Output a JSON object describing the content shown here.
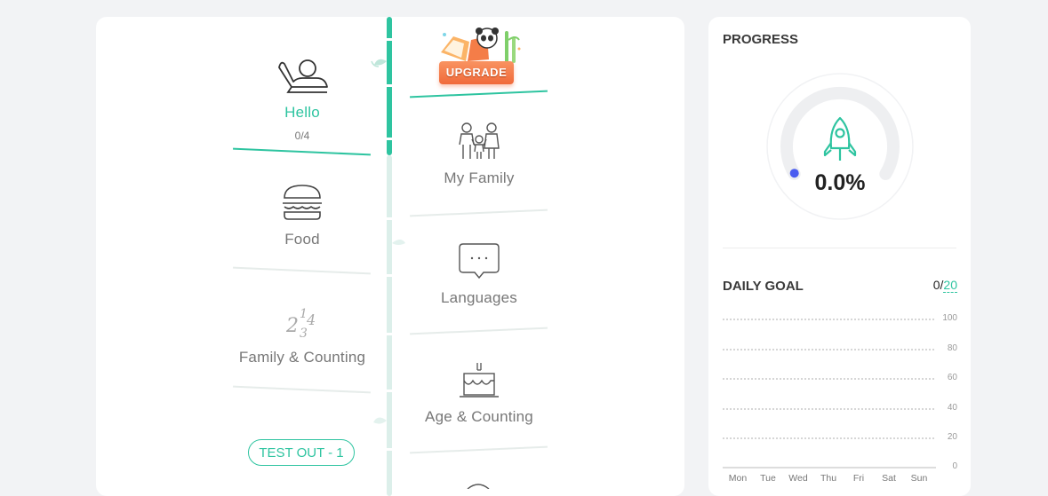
{
  "upgrade": {
    "label": "UPGRADE"
  },
  "lessons_left": [
    {
      "label": "Hello",
      "count": "0/4",
      "icon": "waving-person-icon"
    },
    {
      "label": "Food",
      "icon": "burger-icon"
    },
    {
      "label": "Family & Counting",
      "icon": "numbers-icon"
    }
  ],
  "lessons_right": [
    {
      "label": "My Family",
      "icon": "family-icon"
    },
    {
      "label": "Languages",
      "icon": "speech-bubble-icon"
    },
    {
      "label": "Age & Counting",
      "icon": "birthday-cake-icon"
    }
  ],
  "test_out": {
    "label": "TEST OUT - 1"
  },
  "progress": {
    "title": "PROGRESS",
    "value": "0.0%",
    "fraction": 0.0,
    "icon": "rocket-icon"
  },
  "daily_goal": {
    "title": "DAILY GOAL",
    "current": "0",
    "separator": "/",
    "target": "20",
    "y_ticks": [
      "100",
      "80",
      "60",
      "40",
      "20",
      "0"
    ],
    "days": [
      "Mon",
      "Tue",
      "Wed",
      "Thu",
      "Fri",
      "Sat",
      "Sun"
    ]
  },
  "colors": {
    "accent": "#2ec4a0",
    "dot": "#4a5cf0",
    "upgrade": "#f47d48"
  }
}
